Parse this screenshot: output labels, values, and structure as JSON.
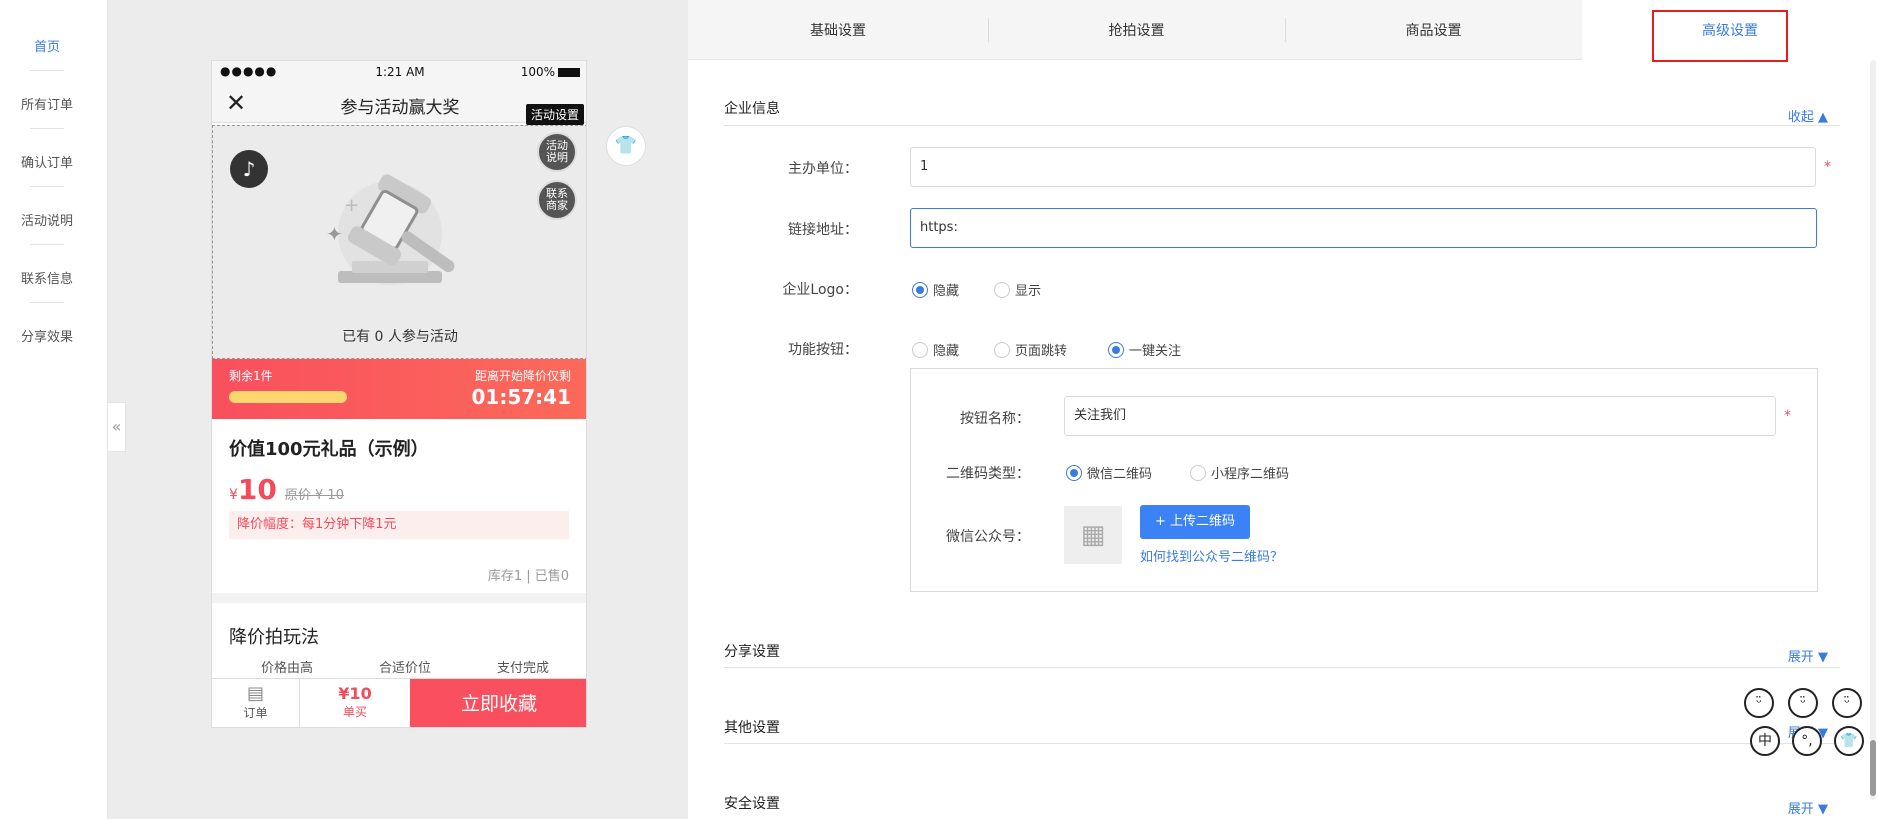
{
  "nav": {
    "items": [
      "首页",
      "所有订单",
      "确认订单",
      "活动说明",
      "联系信息",
      "分享效果"
    ],
    "collapse_glyph": "«"
  },
  "phone": {
    "status": {
      "dots": "●●●●●",
      "time": "1:21 AM",
      "battery": "100%"
    },
    "close_glyph": "✕",
    "title": "参与活动赢大奖",
    "activity_tag": "活动设置",
    "side_buttons": [
      "活动\n说明",
      "联系\n商家"
    ],
    "joined_text": "已有 0 人参与活动",
    "remaining": "剩余1件",
    "progress_fraction": 1.0,
    "countdown_label": "距离开始降价仅剩",
    "countdown": "01:57:41",
    "product_title": "价值100元礼品（示例）",
    "price_symbol": "¥",
    "price": "10",
    "original_price": "原价 ¥ 10",
    "drop_text": "降价幅度：每1分钟下降1元",
    "stock_text": "库存1 | 已售0",
    "play_title": "降价拍玩法",
    "play_items": [
      "价格由高",
      "合适价位",
      "支付完成"
    ],
    "bottom": {
      "order": "订单",
      "buy_price": "¥10",
      "buy": "单买",
      "favorite": "立即收藏"
    }
  },
  "tabs": [
    "基础设置",
    "抢拍设置",
    "商品设置",
    "高级设置"
  ],
  "active_tab": 3,
  "enterprise": {
    "title": "企业信息",
    "toggle": "收起 ▲",
    "host_label": "主办单位：",
    "host_value": "1",
    "link_label": "链接地址：",
    "link_value": "https:",
    "logo_label": "企业Logo：",
    "logo_options": [
      "隐藏",
      "显示"
    ],
    "logo_selected": 0,
    "func_label": "功能按钮：",
    "func_options": [
      "隐藏",
      "页面跳转",
      "一键关注"
    ],
    "func_selected": 2,
    "btn_name_label": "按钮名称：",
    "btn_name_value": "关注我们",
    "qr_type_label": "二维码类型：",
    "qr_options": [
      "微信二维码",
      "小程序二维码"
    ],
    "qr_selected": 0,
    "wechat_label": "微信公众号：",
    "upload_label": "+ 上传二维码",
    "help_link": "如何找到公众号二维码？",
    "required_mark": "*"
  },
  "sections": [
    {
      "title": "分享设置",
      "toggle": "展开 ▼"
    },
    {
      "title": "其他设置",
      "toggle": "展开 ▼"
    },
    {
      "title": "安全设置",
      "toggle": "展开 ▼"
    }
  ],
  "stickers": [
    "中",
    "°,",
    "👕"
  ],
  "colors": {
    "accent": "#3a7be0",
    "danger": "#f34b5b",
    "highlight": "#e02020"
  }
}
